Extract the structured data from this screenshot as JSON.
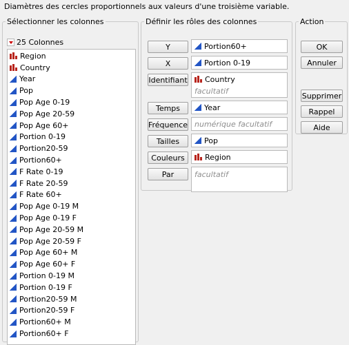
{
  "hint": "Diamètres des cercles proportionnels aux valeurs d'une troisième variable.",
  "select_columns": {
    "title": "Sélectionner les colonnes",
    "count_label": "25 Colonnes",
    "items": [
      {
        "label": "Region",
        "icon": "nominal-icon"
      },
      {
        "label": "Country",
        "icon": "nominal-icon"
      },
      {
        "label": "Year",
        "icon": "continuous-icon"
      },
      {
        "label": "Pop",
        "icon": "continuous-icon"
      },
      {
        "label": "Pop Age 0-19",
        "icon": "continuous-icon"
      },
      {
        "label": "Pop Age 20-59",
        "icon": "continuous-icon"
      },
      {
        "label": "Pop Age 60+",
        "icon": "continuous-icon"
      },
      {
        "label": "Portion 0-19",
        "icon": "continuous-icon"
      },
      {
        "label": "Portion20-59",
        "icon": "continuous-icon"
      },
      {
        "label": "Portion60+",
        "icon": "continuous-icon"
      },
      {
        "label": "F Rate 0-19",
        "icon": "continuous-icon"
      },
      {
        "label": "F Rate 20-59",
        "icon": "continuous-icon"
      },
      {
        "label": "F Rate 60+",
        "icon": "continuous-icon"
      },
      {
        "label": "Pop Age 0-19 M",
        "icon": "continuous-icon"
      },
      {
        "label": "Pop Age 0-19 F",
        "icon": "continuous-icon"
      },
      {
        "label": "Pop Age 20-59 M",
        "icon": "continuous-icon"
      },
      {
        "label": "Pop Age 20-59 F",
        "icon": "continuous-icon"
      },
      {
        "label": "Pop Age 60+ M",
        "icon": "continuous-icon"
      },
      {
        "label": "Pop Age 60+ F",
        "icon": "continuous-icon"
      },
      {
        "label": "Portion 0-19 M",
        "icon": "continuous-icon"
      },
      {
        "label": "Portion 0-19 F",
        "icon": "continuous-icon"
      },
      {
        "label": "Portion20-59 M",
        "icon": "continuous-icon"
      },
      {
        "label": "Portion20-59 F",
        "icon": "continuous-icon"
      },
      {
        "label": "Portion60+ M",
        "icon": "continuous-icon"
      },
      {
        "label": "Portion60+ F",
        "icon": "continuous-icon"
      }
    ]
  },
  "roles": {
    "title": "Définir les rôles des colonnes",
    "y": {
      "button": "Y",
      "value": "Portion60+",
      "icon": "continuous-icon"
    },
    "x": {
      "button": "X",
      "value": "Portion 0-19",
      "icon": "continuous-icon"
    },
    "id": {
      "button": "Identifiant",
      "value": "Country",
      "icon": "nominal-icon",
      "placeholder": "facultatif"
    },
    "time": {
      "button": "Temps",
      "value": "Year",
      "icon": "continuous-icon"
    },
    "freq": {
      "button": "Fréquence",
      "placeholder": "numérique facultatif"
    },
    "sizes": {
      "button": "Tailles",
      "value": "Pop",
      "icon": "continuous-icon"
    },
    "colors": {
      "button": "Couleurs",
      "value": "Region",
      "icon": "nominal-icon"
    },
    "by": {
      "button": "Par",
      "placeholder": "facultatif"
    }
  },
  "action": {
    "title": "Action",
    "ok": "OK",
    "cancel": "Annuler",
    "remove": "Supprimer",
    "recall": "Rappel",
    "help": "Aide"
  }
}
